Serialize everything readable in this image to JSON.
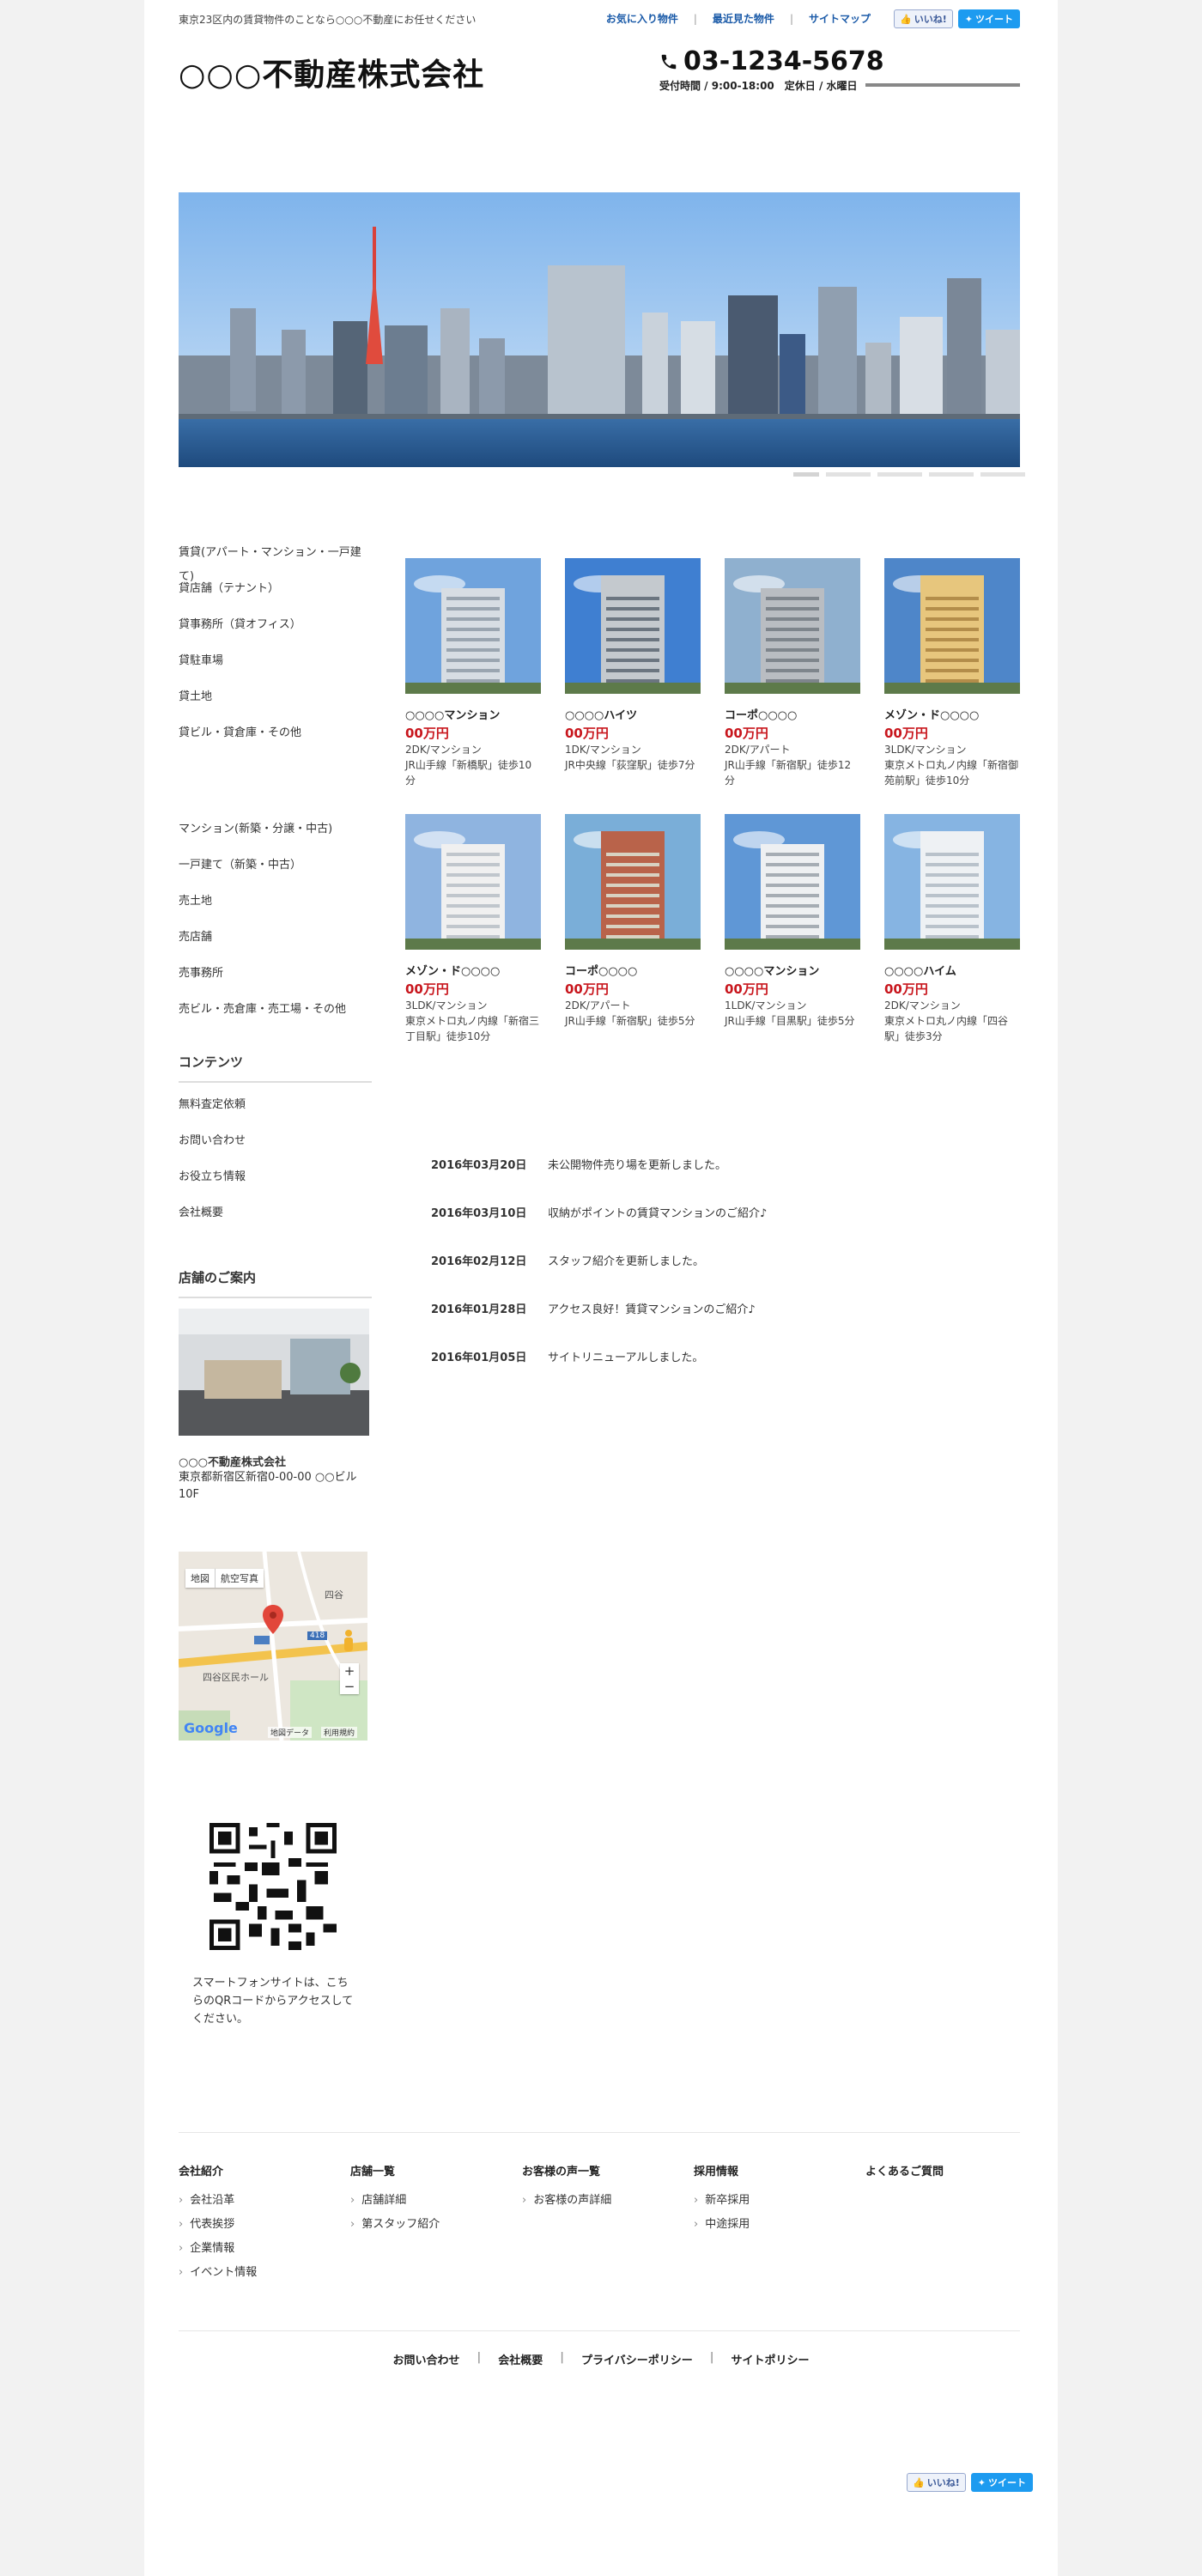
{
  "header": {
    "tagline": "東京23区内の賃貸物件のことなら○○○不動産にお任せください",
    "toplinks": [
      "お気に入り物件",
      "最近見た物件",
      "サイトマップ"
    ],
    "fb_like": "いいね!",
    "tweet": "ツイート",
    "logo": "○○○不動産株式会社",
    "tel": "03-1234-5678",
    "hours": "受付時間 / 9:00-18:00　定休日 / 水曜日"
  },
  "sidebar": {
    "rent_items": [
      "賃貸(アパート・マンション・一戸建て)",
      "貸店舗（テナント）",
      "貸事務所（貸オフィス）",
      "貸駐車場",
      "貸土地",
      "貸ビル・貸倉庫・その他"
    ],
    "sale_items": [
      "マンション(新築・分譲・中古)",
      "一戸建て（新築・中古）",
      "売土地",
      "売店舗",
      "売事務所",
      "売ビル・売倉庫・売工場・その他"
    ],
    "contents_title": "コンテンツ",
    "contents_items": [
      "無料査定依頼",
      "お問い合わせ",
      "お役立ち情報",
      "会社概要"
    ],
    "shop_title": "店舗のご案内",
    "shop_name": "○○○不動産株式会社",
    "shop_address": "東京都新宿区新宿0-00-00 ○○ビル10F",
    "map": {
      "tab_map": "地図",
      "tab_satellite": "航空写真",
      "place1": "四谷",
      "place2": "四谷区民ホール",
      "route": "418",
      "map_data": "地図データ",
      "terms": "利用規約",
      "google": "Google"
    },
    "qr_text": "スマートフォンサイトは、こちらのQRコードからアクセスしてください。"
  },
  "properties": [
    {
      "name": "○○○○マンション",
      "price": "00万円",
      "desc": "2DK/マンション\nJR山手線「新橋駅」徒歩10分"
    },
    {
      "name": "○○○○ハイツ",
      "price": "00万円",
      "desc": "1DK/マンション\nJR中央線「荻窪駅」徒歩7分"
    },
    {
      "name": "コーポ○○○○",
      "price": "00万円",
      "desc": "2DK/アパート\nJR山手線「新宿駅」徒歩12分"
    },
    {
      "name": "メゾン・ド○○○○",
      "price": "00万円",
      "desc": "3LDK/マンション\n東京メトロ丸ノ内線「新宿御苑前駅」徒歩10分"
    },
    {
      "name": "メゾン・ド○○○○",
      "price": "00万円",
      "desc": "3LDK/マンション\n東京メトロ丸ノ内線「新宿三丁目駅」徒歩10分"
    },
    {
      "name": "コーポ○○○○",
      "price": "00万円",
      "desc": "2DK/アパート\nJR山手線「新宿駅」徒歩5分"
    },
    {
      "name": "○○○○マンション",
      "price": "00万円",
      "desc": "1LDK/マンション\nJR山手線「目黒駅」徒歩5分"
    },
    {
      "name": "○○○○ハイム",
      "price": "00万円",
      "desc": "2DK/マンション\n東京メトロ丸ノ内線「四谷駅」徒歩3分"
    }
  ],
  "news": [
    {
      "date": "2016年03月20日",
      "text": "未公開物件売り場を更新しました。"
    },
    {
      "date": "2016年03月10日",
      "text": "収納がポイントの賃貸マンションのご紹介♪"
    },
    {
      "date": "2016年02月12日",
      "text": "スタッフ紹介を更新しました。"
    },
    {
      "date": "2016年01月28日",
      "text": "アクセス良好！賃貸マンションのご紹介♪"
    },
    {
      "date": "2016年01月05日",
      "text": "サイトリニューアルしました。"
    }
  ],
  "footer": {
    "columns": [
      {
        "title": "会社紹介",
        "items": [
          "会社沿革",
          "代表挨拶",
          "企業情報",
          "イベント情報"
        ]
      },
      {
        "title": "店舗一覧",
        "items": [
          "店舗詳細",
          "第スタッフ紹介"
        ]
      },
      {
        "title": "お客様の声一覧",
        "items": [
          "お客様の声詳細"
        ]
      },
      {
        "title": "採用情報",
        "items": [
          "新卒採用",
          "中途採用"
        ]
      },
      {
        "title": "よくあるご質問",
        "items": []
      }
    ],
    "links": [
      "お問い合わせ",
      "会社概要",
      "プライバシーポリシー",
      "サイトポリシー"
    ]
  },
  "colors": {
    "accent_link": "#1a5aa8",
    "price_red": "#c8161d",
    "twitter": "#1d9bf0"
  }
}
